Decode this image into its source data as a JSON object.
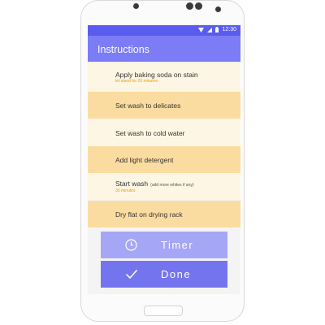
{
  "status_bar": {
    "time": "12:30"
  },
  "app_bar": {
    "title": "Instructions"
  },
  "steps": [
    {
      "label": "Apply baking soda on stain",
      "subtext": "let stand for 20 minutes"
    },
    {
      "label": "Set wash to delicates"
    },
    {
      "label": "Set wash to cold water"
    },
    {
      "label": "Add light detergent"
    },
    {
      "label": "Start wash",
      "note": "(add more whites if any)",
      "subtext": "30 minutes"
    },
    {
      "label": "Dry flat on drying rack"
    }
  ],
  "buttons": {
    "timer_label": "Timer",
    "done_label": "Done"
  },
  "colors": {
    "status_bar": "#5a5cf0",
    "app_bar": "#7b7cf6",
    "step_light": "#fdf6e4",
    "step_dark": "#fbdca0",
    "subtext": "#e6a100",
    "timer_button": "#a6a6f6",
    "done_button": "#7475ee"
  },
  "icons": [
    "wifi-icon",
    "signal-icon",
    "battery-icon",
    "clock-icon",
    "checkmark-icon"
  ]
}
